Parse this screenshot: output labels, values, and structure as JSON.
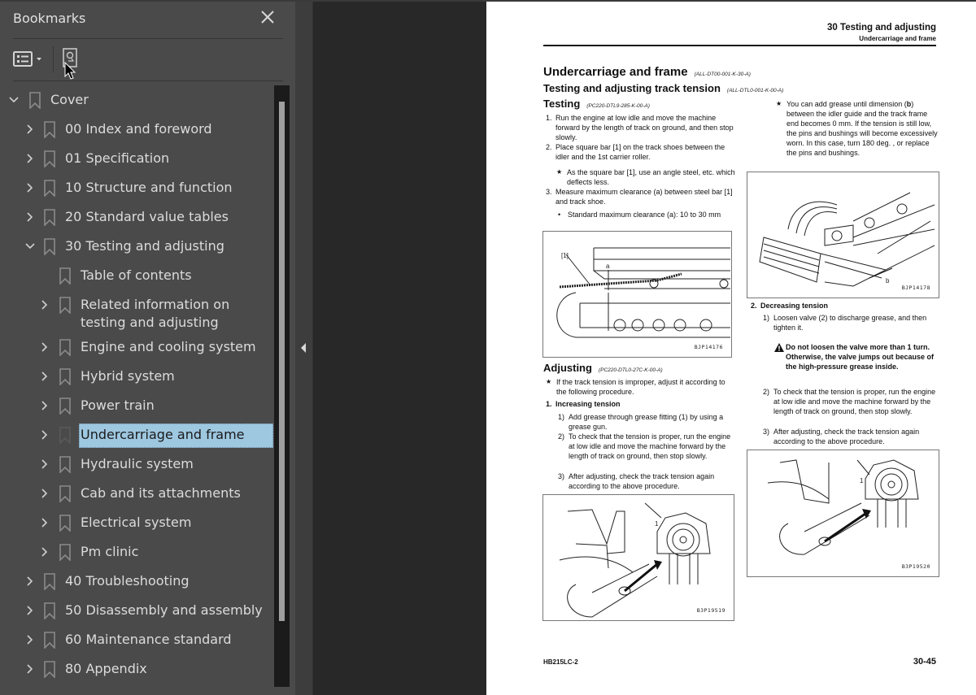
{
  "sidebar": {
    "title": "Bookmarks",
    "close_label": "Close",
    "toolbar": {
      "options_icon": "list-options-icon",
      "find_icon": "find-current-bookmark-icon"
    },
    "items": [
      {
        "label": "Cover",
        "level": 0,
        "expander": "expanded"
      },
      {
        "label": "00 Index and foreword",
        "level": 1,
        "expander": "collapsed"
      },
      {
        "label": "01 Specification",
        "level": 1,
        "expander": "collapsed"
      },
      {
        "label": "10 Structure and function",
        "level": 1,
        "expander": "collapsed"
      },
      {
        "label": "20 Standard value tables",
        "level": 1,
        "expander": "collapsed"
      },
      {
        "label": "30 Testing and adjusting",
        "level": 1,
        "expander": "expanded"
      },
      {
        "label": "Table of contents",
        "level": 2,
        "expander": "none"
      },
      {
        "label": "Related information on testing and adjusting",
        "level": 2,
        "expander": "collapsed"
      },
      {
        "label": "Engine and cooling system",
        "level": 2,
        "expander": "collapsed"
      },
      {
        "label": "Hybrid system",
        "level": 2,
        "expander": "collapsed"
      },
      {
        "label": "Power train",
        "level": 2,
        "expander": "collapsed"
      },
      {
        "label": "Undercarriage and frame",
        "level": 2,
        "expander": "collapsed",
        "selected": true
      },
      {
        "label": "Hydraulic system",
        "level": 2,
        "expander": "collapsed"
      },
      {
        "label": "Cab and its attachments",
        "level": 2,
        "expander": "collapsed"
      },
      {
        "label": "Electrical system",
        "level": 2,
        "expander": "collapsed"
      },
      {
        "label": "Pm clinic",
        "level": 2,
        "expander": "collapsed"
      },
      {
        "label": "40 Troubleshooting",
        "level": 1,
        "expander": "collapsed"
      },
      {
        "label": "50 Disassembly and assembly",
        "level": 1,
        "expander": "collapsed"
      },
      {
        "label": "60 Maintenance standard",
        "level": 1,
        "expander": "collapsed"
      },
      {
        "label": "80 Appendix",
        "level": 1,
        "expander": "collapsed"
      }
    ],
    "selection_color": "#9ec7e0"
  },
  "document": {
    "header": {
      "section": "30 Testing and adjusting",
      "subsection": "Undercarriage and frame"
    },
    "title": "Undercarriage and frame",
    "title_code": "(ALL-DT00-001-K-30-A)",
    "subtitle": "Testing and adjusting track tension",
    "subtitle_code": "(ALL-DTL0-001-K-00-A)",
    "testing": {
      "heading": "Testing",
      "code": "(PC220-DTL9-285-K-00-A)",
      "steps": [
        {
          "num": "1.",
          "text": "Run the engine at low idle and move the machine forward by the length of track on ground, and then stop slowly."
        },
        {
          "num": "2.",
          "text": "Place square bar [1] on the track shoes between the idler and the 1st carrier roller."
        },
        {
          "num": "★",
          "text": "As the square bar [1], use an angle steel, etc. which deflects less."
        },
        {
          "num": "3.",
          "text": "Measure maximum clearance (a) between steel bar [1] and track shoe."
        },
        {
          "num": "•",
          "text": "Standard maximum clearance (a): 10 to 30 mm"
        }
      ],
      "figure_id": "BJP14176",
      "figure_labels": {
        "bar": "[1]",
        "clearance": "a"
      }
    },
    "adjusting": {
      "heading": "Adjusting",
      "code": "(PC220-DTL0-27C-K-00-A)",
      "intro_mark": "★",
      "intro": "If the track tension is improper, adjust it according to the following procedure.",
      "increasing": {
        "num": "1.",
        "heading": "Increasing tension",
        "steps": [
          {
            "num": "1)",
            "text": "Add grease through grease fitting (1) by using a grease gun."
          },
          {
            "num": "2)",
            "text": "To check that the tension is proper, run the engine at low idle and move the machine forward by the length of track on ground, then stop slowly."
          },
          {
            "num": "3)",
            "text": "After adjusting, check the track tension again according to the above procedure."
          }
        ],
        "figure_id": "B3P19519",
        "figure_label": "1"
      }
    },
    "right_column": {
      "note_mark": "★",
      "note_prefix": "You can add grease until dimension (",
      "note_bold": "b",
      "note_suffix": ") between the idler guide and the track frame end becomes 0 mm. If the tension is still low, the pins and bushings will become excessively worn. In this case, turn 180 deg. , or replace the pins and bushings.",
      "figure_id": "BJP14178",
      "figure_label": "b",
      "decreasing": {
        "num": "2.",
        "heading": "Decreasing tension",
        "steps": [
          {
            "num": "1)",
            "text": "Loosen valve (2) to discharge grease, and then tighten it."
          },
          {
            "num": "2)",
            "text": "To check that the tension is proper, run the engine at low idle and move the machine forward by the length of track on ground, then stop slowly."
          },
          {
            "num": "3)",
            "text": "After adjusting, check the track tension again according to the above procedure."
          }
        ],
        "warning": "Do not loosen the valve more than 1 turn. Otherwise, the valve jumps out because of the high-pressure grease inside.",
        "figure_id": "B3P19520",
        "figure_label": "1"
      }
    },
    "footer": {
      "model": "HB215LC-2",
      "page": "30-45"
    }
  }
}
